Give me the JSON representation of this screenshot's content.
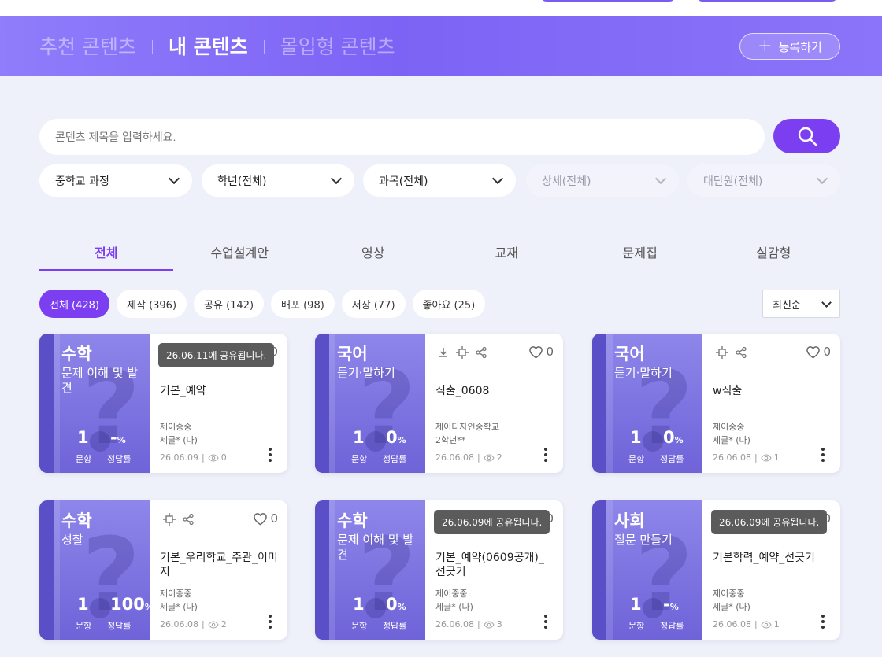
{
  "top_tabs": [
    {
      "label": "추천 콘텐츠",
      "active": false
    },
    {
      "label": "내 콘텐츠",
      "active": true
    },
    {
      "label": "몰입형 콘텐츠",
      "active": false
    }
  ],
  "register_button": {
    "label": "등록하기"
  },
  "search": {
    "placeholder": "콘텐츠 제목을 입력하세요."
  },
  "filters": [
    {
      "label": "중학교 과정",
      "disabled": false
    },
    {
      "label": "학년(전체)",
      "disabled": false
    },
    {
      "label": "과목(전체)",
      "disabled": false
    },
    {
      "label": "상세(전체)",
      "disabled": true
    },
    {
      "label": "대단원(전체)",
      "disabled": true
    }
  ],
  "category_tabs": [
    "전체",
    "수업설계안",
    "영상",
    "교재",
    "문제집",
    "실감형"
  ],
  "chips": [
    "전체 (428)",
    "제작 (396)",
    "공유 (142)",
    "배포 (98)",
    "저장 (77)",
    "좋아요 (25)"
  ],
  "sort": {
    "label": "최신순"
  },
  "labels": {
    "questions": "문항",
    "accuracy": "정답률"
  },
  "cards": [
    {
      "subject": "수학",
      "unit": "문제 이해 및 발견",
      "count": "1",
      "rate": "-",
      "tooltip": "26.06.11에 공유됩니다.",
      "actions": [],
      "likes": "0",
      "title": "기본_예약",
      "school": "제이중중",
      "author": "세글* (나)",
      "date": "26.06.09",
      "views": "0"
    },
    {
      "subject": "국어",
      "unit": "듣기·말하기",
      "count": "1",
      "rate": "0",
      "tooltip": "",
      "actions": [
        "download-icon",
        "share-network-icon",
        "share-icon"
      ],
      "likes": "0",
      "title": "직출_0608",
      "school": "제이디자인중학교",
      "author": "2학년**",
      "date": "26.06.08",
      "views": "2"
    },
    {
      "subject": "국어",
      "unit": "듣기·말하기",
      "count": "1",
      "rate": "0",
      "tooltip": "",
      "actions": [
        "share-network-icon",
        "share-icon"
      ],
      "likes": "0",
      "title": "w직출",
      "school": "제이중중",
      "author": "세글* (나)",
      "date": "26.06.08",
      "views": "1"
    },
    {
      "subject": "수학",
      "unit": "성찰",
      "count": "1",
      "rate": "100",
      "tooltip": "",
      "actions": [
        "share-network-icon",
        "share-icon"
      ],
      "likes": "0",
      "title": "기본_우리학교_주관_이미지",
      "school": "제이중중",
      "author": "세글* (나)",
      "date": "26.06.08",
      "views": "2"
    },
    {
      "subject": "수학",
      "unit": "문제 이해 및 발견",
      "count": "1",
      "rate": "0",
      "tooltip": "26.06.09에 공유됩니다.",
      "actions": [],
      "likes": "0",
      "title": "기본_예약(0609공개)_선긋기",
      "school": "제이중중",
      "author": "세글* (나)",
      "date": "26.06.08",
      "views": "3"
    },
    {
      "subject": "사회",
      "unit": "질문 만들기",
      "count": "1",
      "rate": "-",
      "tooltip": "26.06.09에 공유됩니다.",
      "actions": [],
      "likes": "0",
      "title": "기본학력_예약_선긋기",
      "school": "제이중중",
      "author": "세글* (나)",
      "date": "26.06.08",
      "views": "1"
    }
  ],
  "colors": {
    "brand": "#7c3ef1",
    "banner": "#8b74f9",
    "card_left": "#7d72e0"
  }
}
